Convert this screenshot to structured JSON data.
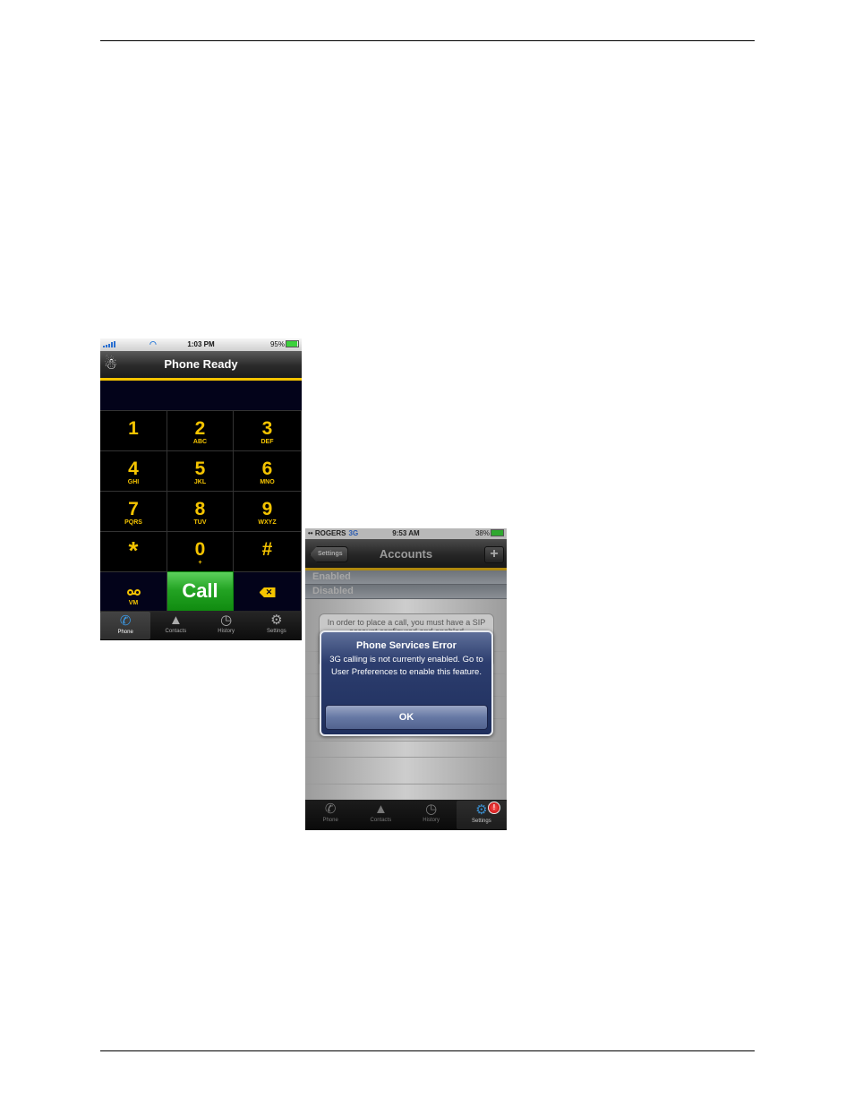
{
  "page": {
    "rules": [
      "top",
      "bottom"
    ]
  },
  "screenshot1": {
    "status_bar": {
      "time": "1:03 PM",
      "battery": "95%"
    },
    "nav": {
      "title": "Phone Ready",
      "logo_icon": "app-logo-icon"
    },
    "keys": [
      {
        "num": "1",
        "letters": ""
      },
      {
        "num": "2",
        "letters": "ABC"
      },
      {
        "num": "3",
        "letters": "DEF"
      },
      {
        "num": "4",
        "letters": "GHI"
      },
      {
        "num": "5",
        "letters": "JKL"
      },
      {
        "num": "6",
        "letters": "MNO"
      },
      {
        "num": "7",
        "letters": "PQRS"
      },
      {
        "num": "8",
        "letters": "TUV"
      },
      {
        "num": "9",
        "letters": "WXYZ"
      },
      {
        "num": "*",
        "letters": ""
      },
      {
        "num": "0",
        "letters": "+"
      },
      {
        "num": "#",
        "letters": ""
      }
    ],
    "voicemail_label": "VM",
    "call_label": "Call",
    "tabs": [
      {
        "label": "Phone",
        "icon": "phone-icon",
        "active": true
      },
      {
        "label": "Contacts",
        "icon": "contacts-icon",
        "active": false
      },
      {
        "label": "History",
        "icon": "clock-icon",
        "active": false
      },
      {
        "label": "Settings",
        "icon": "gear-icon",
        "active": false
      }
    ]
  },
  "screenshot2": {
    "status_bar": {
      "carrier": "ROGERS",
      "network": "3G",
      "time": "9:53 AM",
      "battery": "38%"
    },
    "nav": {
      "back_label": "Settings",
      "title": "Accounts",
      "add_label": "+"
    },
    "segments": [
      "Enabled",
      "Disabled"
    ],
    "background_text": "In order to place a call, you must have a SIP account configured and enabled",
    "alert": {
      "title": "Phone Services Error",
      "message": "3G calling is not currently enabled. Go to User Preferences to enable this feature.",
      "ok_label": "OK"
    },
    "tabs": [
      {
        "label": "Phone",
        "icon": "phone-icon",
        "active": false
      },
      {
        "label": "Contacts",
        "icon": "contacts-icon",
        "active": false
      },
      {
        "label": "History",
        "icon": "clock-icon",
        "active": false
      },
      {
        "label": "Settings",
        "icon": "gear-icon",
        "active": true,
        "badge": "!"
      }
    ]
  },
  "colors": {
    "accent_yellow": "#f5c400",
    "call_green": "#23a323",
    "navy": "#03031a",
    "alert_blue": "#2c3d6e"
  }
}
